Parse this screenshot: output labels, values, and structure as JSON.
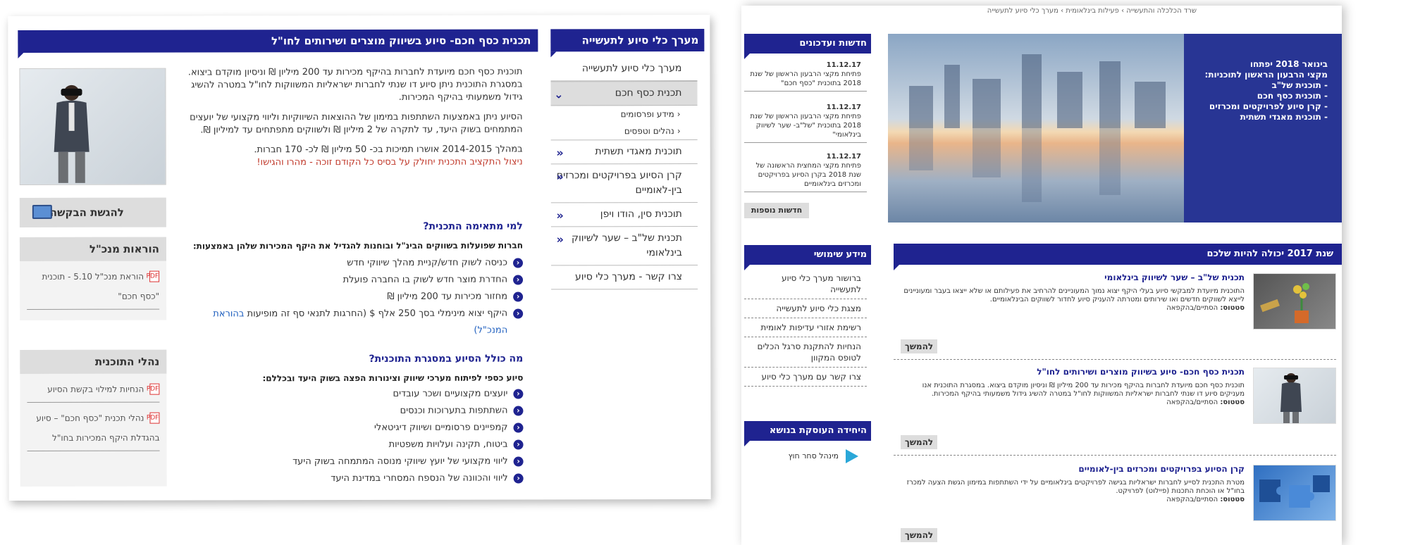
{
  "left_page": {
    "main_title": "תכנית כסף חכם- סיוע בשיווק מוצרים ושירותים לחו\"ל",
    "side_title": "מערך כלי סיוע לתעשייה",
    "side_menu": [
      {
        "label": "מערך כלי סיוע לתעשייה"
      },
      {
        "label": "תכנית כסף חכם",
        "active": true
      },
      {
        "label": "מידע ופרסומים",
        "sub": true
      },
      {
        "label": "נהלים וטפסים",
        "sub": true
      },
      {
        "label": "תוכנית מאגדי תשתית"
      },
      {
        "label": "קרן הסיוע בפרויקטים ומכרזים בין-לאומיים"
      },
      {
        "label": "תוכנית סין, הודו ויפן"
      },
      {
        "label": "תכנית של\"ב – שער לשיווק בינלאומי"
      },
      {
        "label": "צרו קשר - מערך כלי סיוע"
      }
    ],
    "intro_p1": "תוכנית כסף חכם מיועדת לחברות בהיקף מכירות עד 200 מיליון ₪ וניסיון מוקדם ביצוא. במסגרת התוכנית ניתן סיוע דו שנתי לחברות ישראליות המשווקות לחו\"ל במטרה להשיג גידול משמעותי בהיקף המכירות.",
    "intro_p2": "הסיוע ניתן באמצעות השתתפות במימון של ההוצאות השיווקיות וליווי מקצועי של יועצים המתמחים בשוק היעד, עד לתקרה של 2 מיליון ₪ ולשווקים מתפתחים עד למיליון ₪.",
    "intro_p3": "במהלך 2014-2015 אושרו תמיכות בכ- 50 מיליון ₪ לכ- 170 חברות.",
    "intro_p4": "ניצול התקציב התכנית יחולק על בסיס כל הקודם זוכה - מהרו והגישו!",
    "apply_label": "להגשת הבקשה",
    "guidelines_title": "הוראות מנכ\"ל",
    "guidelines_item": "הוראת מנכ\"ל 5.10 - תוכנית \"כסף חכם\"",
    "procedures_title": "נהלי התוכנית",
    "procedures_items": [
      "הנחיות למילוי בקשת הסיוע",
      "נהלי תכנית \"כסף חכם\" – סיוע בהגדלת היקף המכירות בחו\"ל"
    ],
    "who_title": "למי מתאימה התכנית?",
    "who_lead": "חברות שפועלות בשווקים הבינ\"ל ובוחנות להגדיל את היקף המכירות שלהן באמצעות:",
    "who_items": [
      "כניסה לשוק חדש/קניית מהלך שיווקי חדש",
      "החדרת מוצר חדש לשוק בו החברה פועלת",
      "מחזור מכירות עד 200 מיליון ₪",
      "היקף יצוא מינימלי בסך 250 אלף $ (החרגות לתנאי סף זה מופיעות"
    ],
    "who_link": "בהוראת המנכ\"ל)",
    "what_title": "מה כולל הסיוע במסגרת התוכנית?",
    "what_lead": "סיוע כספי לפיתוח מערכי שיווק וצינורות הפצה בשוק היעד ובכללם:",
    "what_items": [
      "יועצים מקצועיים ושכר עובדים",
      "השתתפות בתערוכות וכנסים",
      "קמפיינים פרסומיים ושיווק דיגיטאלי",
      "ביטוח, תקינה ועלויות משפטיות",
      "ליווי מקצועי של יועץ שיווקי מנוסה המתמחה בשוק היעד",
      "ליווי והכוונה של הנספח המסחרי במדינת היעד"
    ]
  },
  "right_page": {
    "breadcrumb": "שרד הכלכלה והתעשייה › פעילות בינלאומית › מערך כלי סיוע לתעשייה",
    "news_title": "חדשות ועדכונים",
    "news": [
      {
        "date": "11.12.17",
        "text": "פתיחת מקצי הרבעון הראשון של שנת 2018 בתוכנית \"כסף חכם\""
      },
      {
        "date": "11.12.17",
        "text": "פתיחת מקצי הרבעון הראשון של שנת 2018 בתוכנית \"של\"ב- שער לשיווק בינלאומי\""
      },
      {
        "date": "11.12.17",
        "text": "פתיחת מקצי המחצית הראשונה של שנת 2018 בקרן הסיוע בפרויקטים ומכרזים בינלאומיים"
      }
    ],
    "more_news": "חדשות נוספות",
    "promo_lines": [
      "בינואר 2018 יפתחו",
      "מקצי הרבעון הראשון לתוכניות:",
      "- תוכנית של\"ב",
      "- תוכנית כסף חכם",
      "- קרן סיוע לפרויקטים ומכרזים",
      "- תוכנית מאגדי תשתית"
    ],
    "useful_title": "מידע שימושי",
    "useful_items": [
      "ברושור מערך כלי סיוע לתעשייה",
      "מצגת כלי סיוע לתעשייה",
      "רשימת אזורי עדיפות לאומית",
      "הנחיות להתקנת סרגל הכלים לטופס המקוון",
      "צרו קשר עם מערך כלי סיוע"
    ],
    "unit_title": "היחידה העוסקת בנושא",
    "unit_name": "מינהל סחר חוץ",
    "year_title": "שנת 2017 יכולה להיות שלכם",
    "programs": [
      {
        "title": "תכנית של\"ב – שער לשיווק בינלאומי",
        "desc": "התוכנית מיועדת למבקשי סיוע בעלי היקף יצוא נמוך המעוניינים להרחיב את פעילותם או שלא ייצאו בעבר ומעוניינים לייצא לשווקים חדשים ואו שירותים ומטרתה להעניק סיוע לחדור לשווקים הבינלאומיים.",
        "status_label": "סטטוס:",
        "status": "הסתיים/בהקפאה",
        "button": "להמשך"
      },
      {
        "title": "תכנית כסף חכם- סיוע בשיווק מוצרים ושירותים לחו\"ל",
        "desc": "תוכנית כסף חכם מיועדת לחברות בהיקף מכירות עד 200 מיליון ₪ וניסיון מוקדם ביצוא. במסגרת התוכנית אנו מעניקים סיוע דו שנתי לחברות ישראליות המשווקות לחו\"ל במטרה להשיג גידול משמעותי בהיקף המכירות.",
        "status_label": "סטטוס:",
        "status": "הסתיים/בהקפאה",
        "button": "להמשך"
      },
      {
        "title": "קרן הסיוע בפרויקטים ומכרזים בין-לאומיים",
        "desc": "מטרת התכנית לסייע לחברות ישראליות בגישה לפרויקטים בינלאומיים על ידי השתתפות במימון הגשת הצעה למכרז בחו\"ל או הוכחת התכנות (פיילוט) לפרויקט.",
        "status_label": "סטטוס:",
        "status": "הסתיים/בהקפאה",
        "button": "להמשך"
      }
    ]
  },
  "colors": {
    "navy": "#1f2390",
    "promo": "#283594",
    "gray": "#dddddd"
  }
}
